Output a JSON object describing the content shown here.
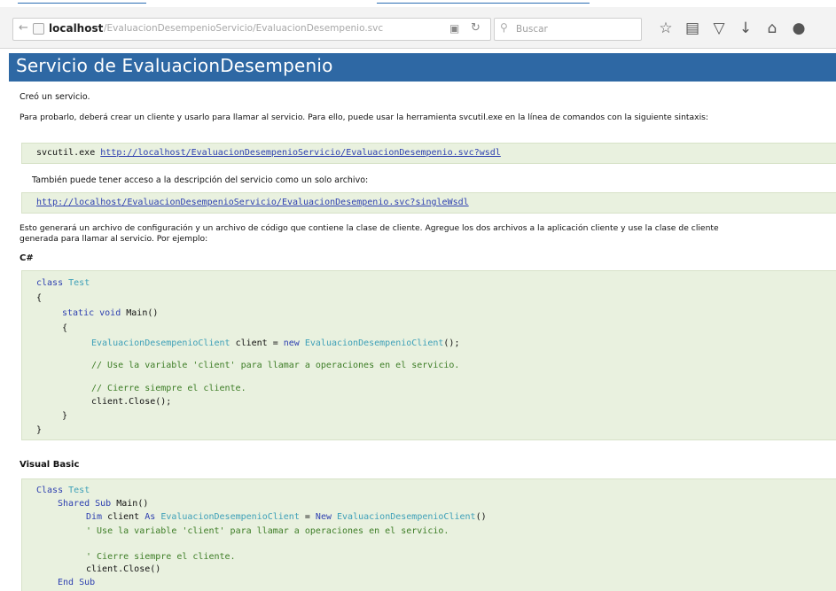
{
  "browser": {
    "host": "localhost",
    "path": "/EvaluacionDesempenioServicio/EvaluacionDesempenio.svc",
    "search_placeholder": "Buscar",
    "icons": [
      "star-icon",
      "reading-list-icon",
      "pocket-icon",
      "download-icon",
      "home-icon",
      "chat-icon"
    ]
  },
  "page": {
    "title": "Servicio de EvaluacionDesempenio",
    "created": "Creó un servicio.",
    "intro": "Para probarlo, deberá crear un cliente y usarlo para llamar al servicio. Para ello, puede usar la herramienta svcutil.exe en la línea de comandos con la siguiente sintaxis:",
    "svcutil_cmd": "svcutil.exe",
    "wsdl_url": "http://localhost/EvaluacionDesempenioServicio/EvaluacionDesempenio.svc?wsdl",
    "single_file_text": "También puede tener acceso a la descripción del servicio como un solo archivo:",
    "single_wsdl_url": "http://localhost/EvaluacionDesempenioServicio/EvaluacionDesempenio.svc?singleWsdl",
    "generate_text_1": "Esto generará un archivo de configuración y un archivo de código que contiene la clase de cliente. Agregue los dos archivos a la aplicación cliente y use la clase de cliente",
    "generate_text_2": "generada para llamar al servicio. Por ejemplo:",
    "csharp_heading": "C#",
    "vb_heading": "Visual Basic"
  },
  "csharp": {
    "kw_class": "class",
    "class_name": "Test",
    "brace_open": "{",
    "brace_close": "}",
    "kw_static_void": "static void",
    "main_sig": "Main()",
    "client_type": "EvaluacionDesempenioClient",
    "client_var": " client = ",
    "kw_new": "new",
    "client_ctor": "EvaluacionDesempenioClient",
    "ctor_end": "();",
    "comment_use": "// Use la variable 'client' para llamar a operaciones en el servicio.",
    "comment_close": "// Cierre siempre el cliente.",
    "close_call": "client.Close();"
  },
  "vb": {
    "kw_class": "Class",
    "class_name": "Test",
    "kw_shared_sub": "Shared Sub",
    "main_sig": "Main()",
    "kw_dim": "Dim",
    "dim_var": " client ",
    "kw_as": "As",
    "client_type": "EvaluacionDesempenioClient",
    "eq": " = ",
    "kw_new": "New",
    "client_ctor": "EvaluacionDesempenioClient",
    "ctor_end": "()",
    "comment_use": "' Use la variable 'client' para llamar a operaciones en el servicio.",
    "comment_close": "' Cierre siempre el cliente.",
    "close_call": "client.Close()",
    "kw_end_sub": "End Sub"
  }
}
